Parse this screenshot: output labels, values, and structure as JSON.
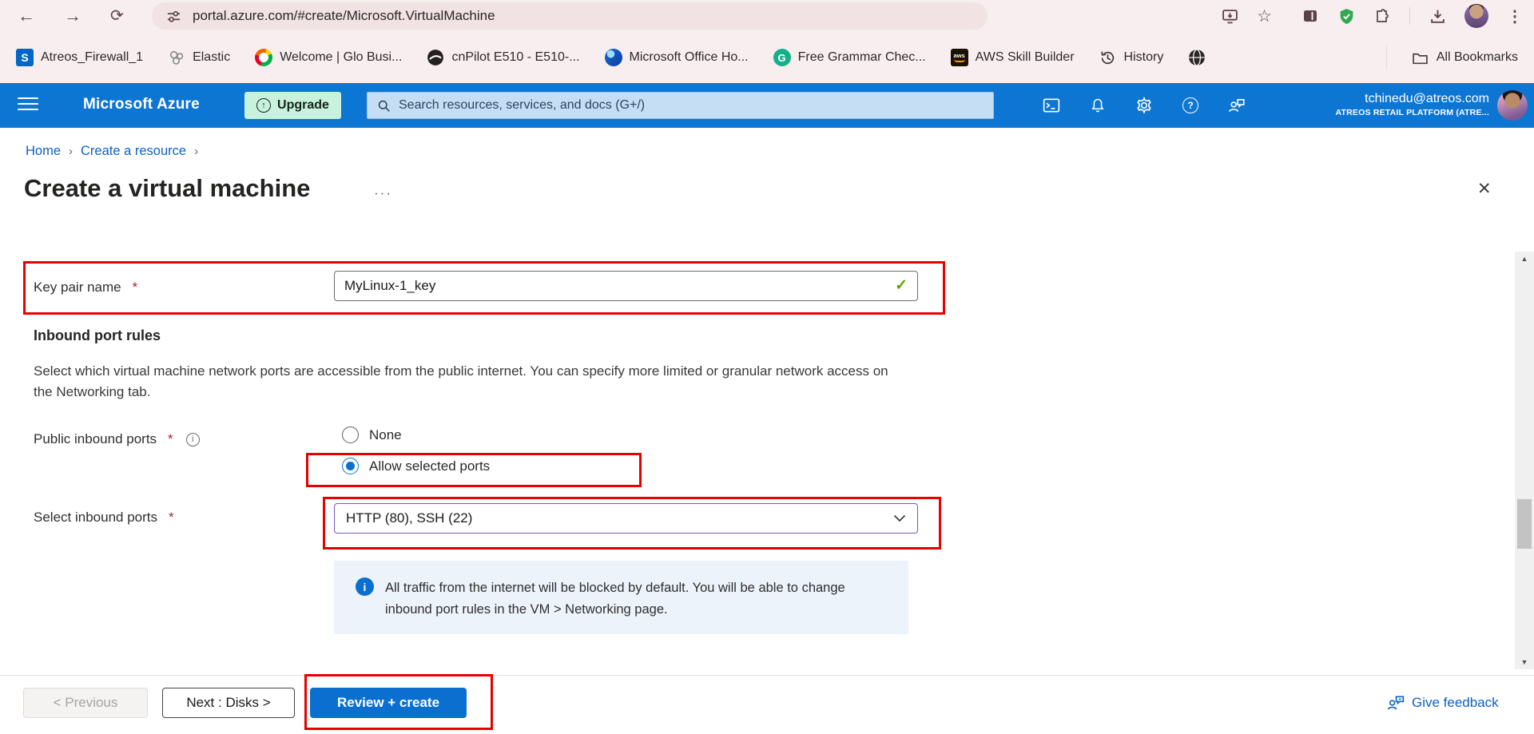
{
  "browser": {
    "url": "portal.azure.com/#create/Microsoft.VirtualMachine",
    "bookmarks": [
      "Atreos_Firewall_1",
      "Elastic",
      "Welcome | Glo Busi...",
      "cnPilot E510 - E510-...",
      "Microsoft Office Ho...",
      "Free Grammar Chec...",
      "AWS Skill Builder",
      "History"
    ],
    "all_bookmarks": "All Bookmarks",
    "favicon_letters": {
      "sophos": "S",
      "grammar": "G",
      "aws": "aws"
    }
  },
  "azure": {
    "brand": "Microsoft Azure",
    "upgrade": "Upgrade",
    "search_placeholder": "Search resources, services, and docs (G+/)",
    "email": "tchinedu@atreos.com",
    "tenant": "ATREOS RETAIL PLATFORM (ATRE..."
  },
  "breadcrumb": {
    "home": "Home",
    "create_resource": "Create a resource"
  },
  "page": {
    "title": "Create a virtual machine"
  },
  "form": {
    "required_mark": "*",
    "key_pair_label": "Key pair name",
    "key_pair_value": "MyLinux-1_key",
    "section_heading": "Inbound port rules",
    "section_description": "Select which virtual machine network ports are accessible from the public internet. You can specify more limited or granular network access on the Networking tab.",
    "public_inbound_label": "Public inbound ports",
    "radio_none": "None",
    "radio_allow": "Allow selected ports",
    "select_ports_label": "Select inbound ports",
    "select_ports_value": "HTTP (80), SSH (22)",
    "info_text": "All traffic from the internet will be blocked by default. You will be able to change inbound port rules in the VM > Networking page."
  },
  "footer": {
    "previous": "< Previous",
    "next": "Next : Disks >",
    "review_create": "Review + create",
    "feedback": "Give feedback"
  },
  "icons": {
    "back": "←",
    "forward": "→",
    "reload": "⟳",
    "star": "☆",
    "menu_dots": "⋮",
    "more": "···",
    "close": "✕",
    "check": "✓",
    "crumb_sep": "›",
    "up_arrow": "↑",
    "info_i": "i",
    "help_q": "?",
    "scroll_up": "▲",
    "scroll_down": "▼"
  },
  "colors": {
    "azure_blue": "#0d76d3",
    "annotation_red": "#e60000",
    "primary_button": "#0b6fd0",
    "upgrade_mint": "#c9f2dc",
    "info_bg": "#ecf3fb",
    "valid_green": "#57a300",
    "dropdown_border": "#7b52c0"
  }
}
